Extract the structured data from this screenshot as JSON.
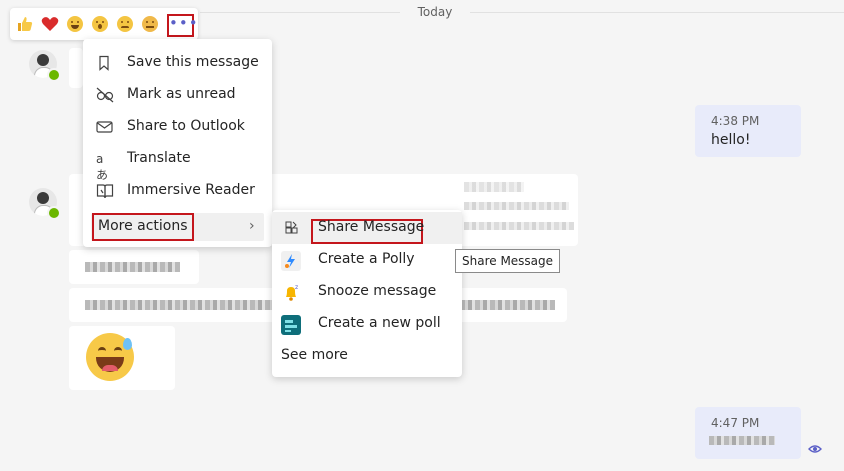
{
  "date_divider": {
    "label": "Today"
  },
  "reactions": [
    {
      "name": "like-icon",
      "glyph": "👍"
    },
    {
      "name": "heart-icon",
      "glyph": "♥"
    },
    {
      "name": "laugh-icon",
      "glyph": ""
    },
    {
      "name": "surprised-icon",
      "glyph": ""
    },
    {
      "name": "sad-icon",
      "glyph": ""
    },
    {
      "name": "angry-icon",
      "glyph": ""
    }
  ],
  "more_options": {
    "glyph": "•••"
  },
  "context_menu": {
    "items": [
      {
        "icon": "bookmark-icon",
        "label": "Save this message"
      },
      {
        "icon": "mark-unread-icon",
        "label": "Mark as unread"
      },
      {
        "icon": "mail-icon",
        "label": "Share to Outlook"
      },
      {
        "icon": "translate-icon",
        "label": "Translate"
      },
      {
        "icon": "immersive-reader-icon",
        "label": "Immersive Reader"
      }
    ],
    "more_actions": {
      "label": "More actions",
      "chevron": "›"
    }
  },
  "submenu": {
    "items": [
      {
        "icon": "share-message-icon",
        "label": "Share Message"
      },
      {
        "icon": "polly-icon",
        "label": "Create a Polly"
      },
      {
        "icon": "snooze-bell-icon",
        "label": "Snooze message"
      },
      {
        "icon": "poll-icon",
        "label": "Create a new poll"
      }
    ],
    "see_more": "See more"
  },
  "tooltip": {
    "text": "Share Message"
  },
  "my_messages": [
    {
      "time": "4:38 PM",
      "text": "hello!"
    },
    {
      "time": "4:47 PM",
      "text": ""
    }
  ],
  "colors": {
    "accent": "#5b5fc7",
    "highlight_box": "#c4161c",
    "my_bubble": "#e8ebfa"
  }
}
